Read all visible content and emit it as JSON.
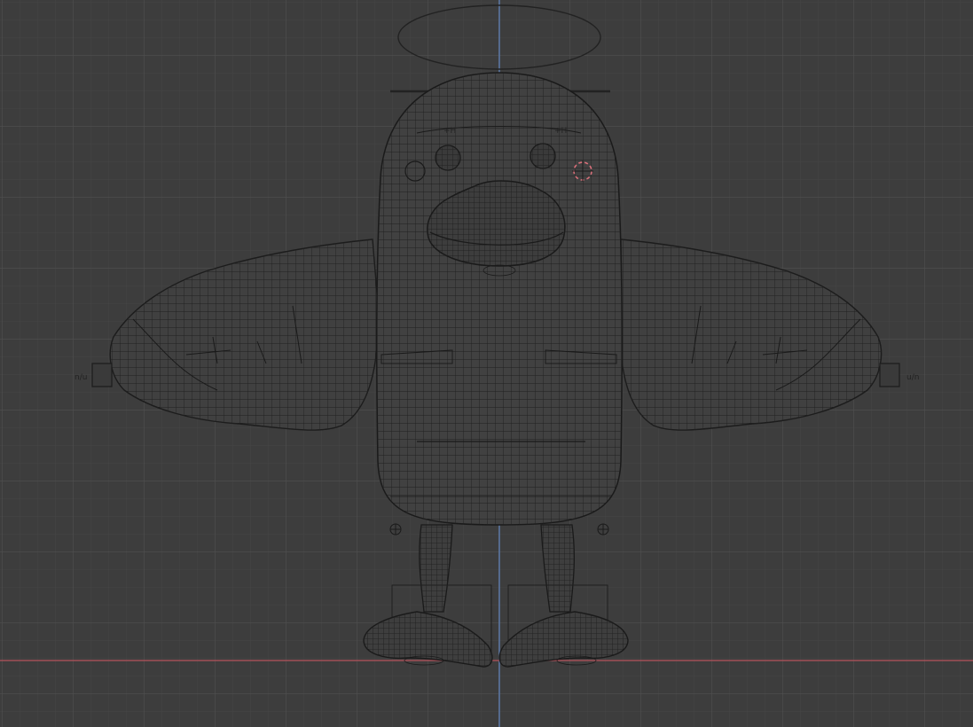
{
  "viewport": {
    "background": "#3d3d3d",
    "grid_minor_color": "#444444",
    "grid_major_color": "#4d4d4d",
    "x_axis_color": "#b5525c",
    "z_axis_color": "#5e7fb5",
    "mesh_fill": "#3e3e3e",
    "wire_color": "#1f1f1f",
    "cursor_color": "#d8707a"
  },
  "model": {
    "subject": "duck-character",
    "display_mode": "wireframe",
    "visible_parts": [
      "halo",
      "head-body",
      "wing-left",
      "wing-right",
      "eye-left",
      "eye-right",
      "bill",
      "leg-left",
      "leg-right",
      "foot-left",
      "foot-right"
    ]
  },
  "cursor_3d": {
    "icon": "3d-cursor-icon"
  }
}
